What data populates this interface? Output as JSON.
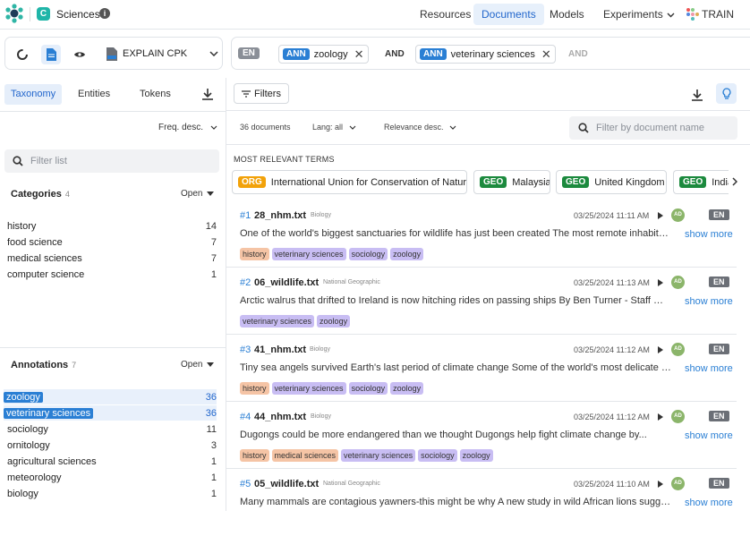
{
  "app": {
    "title": "Sciences",
    "icon_letter": "C"
  },
  "nav": {
    "items": [
      "Resources",
      "Documents",
      "Models",
      "Experiments"
    ],
    "active": "Documents",
    "train_label": "TRAIN"
  },
  "toolbar": {
    "model_label": "EXPLAIN CPK"
  },
  "query": {
    "lang": "EN",
    "chips": [
      {
        "tag": "ANN",
        "label": "zoology"
      },
      {
        "tag": "ANN",
        "label": "veterinary sciences"
      }
    ],
    "and_label": "AND",
    "and_placeholder": "AND"
  },
  "left": {
    "tabs": [
      "Taxonomy",
      "Entities",
      "Tokens"
    ],
    "sort_label": "Freq. desc.",
    "filter_placeholder": "Filter list",
    "categories": {
      "title": "Categories",
      "count": "4",
      "open_label": "Open",
      "items": [
        {
          "label": "history",
          "count": "14"
        },
        {
          "label": "food science",
          "count": "7"
        },
        {
          "label": "medical sciences",
          "count": "7"
        },
        {
          "label": "computer science",
          "count": "1"
        }
      ]
    },
    "annotations": {
      "title": "Annotations",
      "count": "7",
      "open_label": "Open",
      "items": [
        {
          "label": "zoology",
          "count": "36",
          "selected": true
        },
        {
          "label": "veterinary sciences",
          "count": "36",
          "selected": true
        },
        {
          "label": "sociology",
          "count": "11"
        },
        {
          "label": "ornitology",
          "count": "3"
        },
        {
          "label": "agricultural sciences",
          "count": "1"
        },
        {
          "label": "meteorology",
          "count": "1"
        },
        {
          "label": "biology",
          "count": "1"
        }
      ]
    }
  },
  "main": {
    "filters_label": "Filters",
    "doc_count": "36 documents",
    "lang_filter": "Lang: all",
    "relevance": "Relevance desc.",
    "doc_filter_placeholder": "Filter by document name",
    "most_relevant_label": "MOST RELEVANT TERMS",
    "terms": [
      {
        "tag": "ORG",
        "label": "International Union for Conservation of Nature",
        "color": "#f2a20a"
      },
      {
        "tag": "GEO",
        "label": "Malaysia",
        "color": "#1c8a3e"
      },
      {
        "tag": "GEO",
        "label": "United Kingdom",
        "color": "#1c8a3e"
      },
      {
        "tag": "GEO",
        "label": "India",
        "color": "#1c8a3e"
      }
    ],
    "show_more": "show more",
    "documents": [
      {
        "num": "#1",
        "name": "28_nhm.txt",
        "source": "Biology",
        "date": "03/25/2024 11:11 AM",
        "avatar": "AD",
        "lang": "EN",
        "snippet": "One of the world's biggest sanctuaries for wildlife has just been created The most remote inhabited...",
        "tags": [
          "history",
          "veterinary sciences",
          "sociology",
          "zoology"
        ]
      },
      {
        "num": "#2",
        "name": "06_wildlife.txt",
        "source": "National Geographic",
        "date": "03/25/2024 11:13 AM",
        "avatar": "AD",
        "lang": "EN",
        "snippet": "Arctic walrus that drifted to Ireland is now hitching rides on passing ships By Ben Turner - Staff Writer ...",
        "tags": [
          "veterinary sciences",
          "zoology"
        ]
      },
      {
        "num": "#3",
        "name": "41_nhm.txt",
        "source": "Biology",
        "date": "03/25/2024 11:12 AM",
        "avatar": "AD",
        "lang": "EN",
        "snippet": "Tiny sea angels survived Earth's last period of climate change Some of the world's most delicate mari...",
        "tags": [
          "history",
          "veterinary sciences",
          "sociology",
          "zoology"
        ]
      },
      {
        "num": "#4",
        "name": "44_nhm.txt",
        "source": "Biology",
        "date": "03/25/2024 11:12 AM",
        "avatar": "AD",
        "lang": "EN",
        "snippet": "Dugongs could be more endangered than we thought Dugongs help fight climate change by...",
        "tags": [
          "history",
          "medical sciences",
          "veterinary sciences",
          "sociology",
          "zoology"
        ]
      },
      {
        "num": "#5",
        "name": "05_wildlife.txt",
        "source": "National Geographic",
        "date": "03/25/2024 11:10 AM",
        "avatar": "AD",
        "lang": "EN",
        "snippet": "Many mammals are contagious yawners-this might be why A new study in wild African lions suggests...",
        "tags": []
      }
    ]
  }
}
